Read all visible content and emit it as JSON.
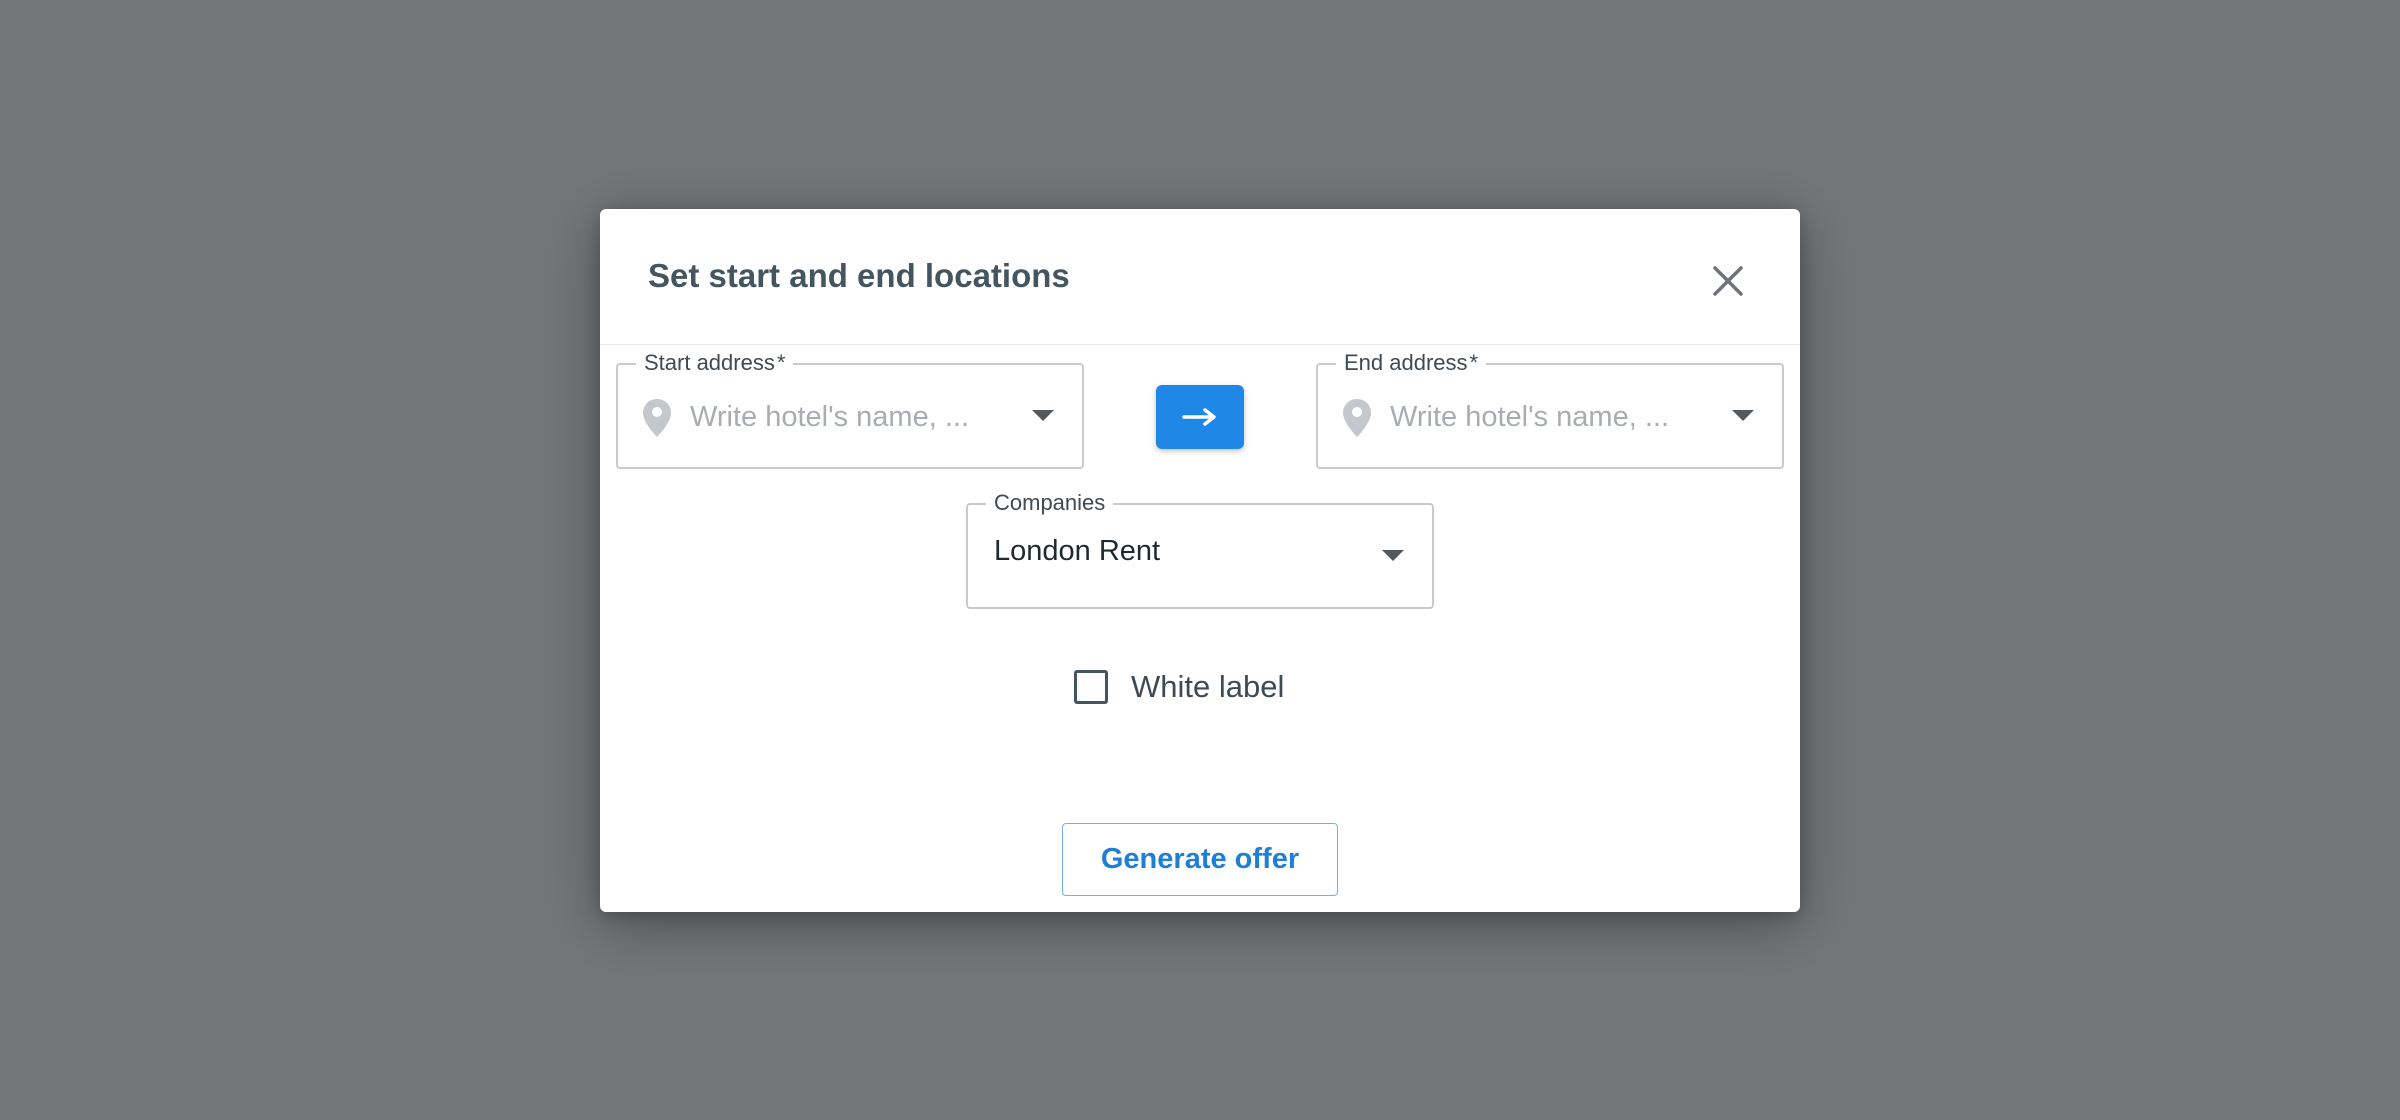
{
  "dialog": {
    "title": "Set start and end locations",
    "close_icon": "close-icon"
  },
  "start_address": {
    "label": "Start address",
    "required_mark": "*",
    "placeholder": "Write hotel's name, ...",
    "value": "",
    "icon": "location-pin-icon"
  },
  "swap_button": {
    "icon": "arrow-right-icon",
    "color": "#1f87e5"
  },
  "end_address": {
    "label": "End address",
    "required_mark": "*",
    "placeholder": "Write hotel's name, ...",
    "value": "",
    "icon": "location-pin-icon"
  },
  "companies": {
    "label": "Companies",
    "selected": "London Rent"
  },
  "white_label": {
    "label": "White label",
    "checked": false
  },
  "generate_button": {
    "label": "Generate offer"
  },
  "colors": {
    "accent": "#1f87e5",
    "title": "#445560",
    "backdrop": "#74777a"
  }
}
